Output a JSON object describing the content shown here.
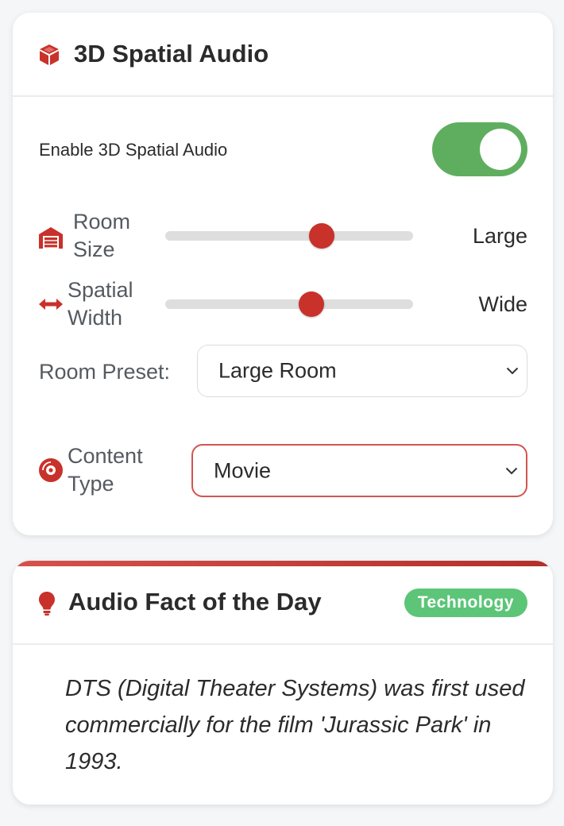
{
  "spatial_audio": {
    "title": "3D Spatial Audio",
    "title_icon": "cube-icon",
    "enable_label": "Enable 3D Spatial Audio",
    "enabled": true,
    "room_size": {
      "label_line1": "Room",
      "label_line2": "Size",
      "icon": "warehouse-icon",
      "level": 0.63,
      "value": "Large"
    },
    "spatial_width": {
      "label_line1": "Spatial",
      "label_line2": "Width",
      "icon": "arrows-left-right-icon",
      "level": 0.59,
      "value": "Wide"
    },
    "room_preset": {
      "label": "Room Preset:",
      "selected": "Large Room"
    },
    "content_type": {
      "label_line1": "Content",
      "label_line2": "Type",
      "icon": "compact-disc-icon",
      "selected": "Movie"
    }
  },
  "fact": {
    "title": "Audio Fact of the Day",
    "title_icon": "lightbulb-icon",
    "badge": "Technology",
    "text": "DTS (Digital Theater Systems) was first used commercially for the film 'Jurassic Park' in 1993."
  },
  "colors": {
    "accent": "#c9312b",
    "toggle_on": "#5fae5f",
    "badge_bg": "#5cc578",
    "page_bg": "#f5f6f8"
  }
}
